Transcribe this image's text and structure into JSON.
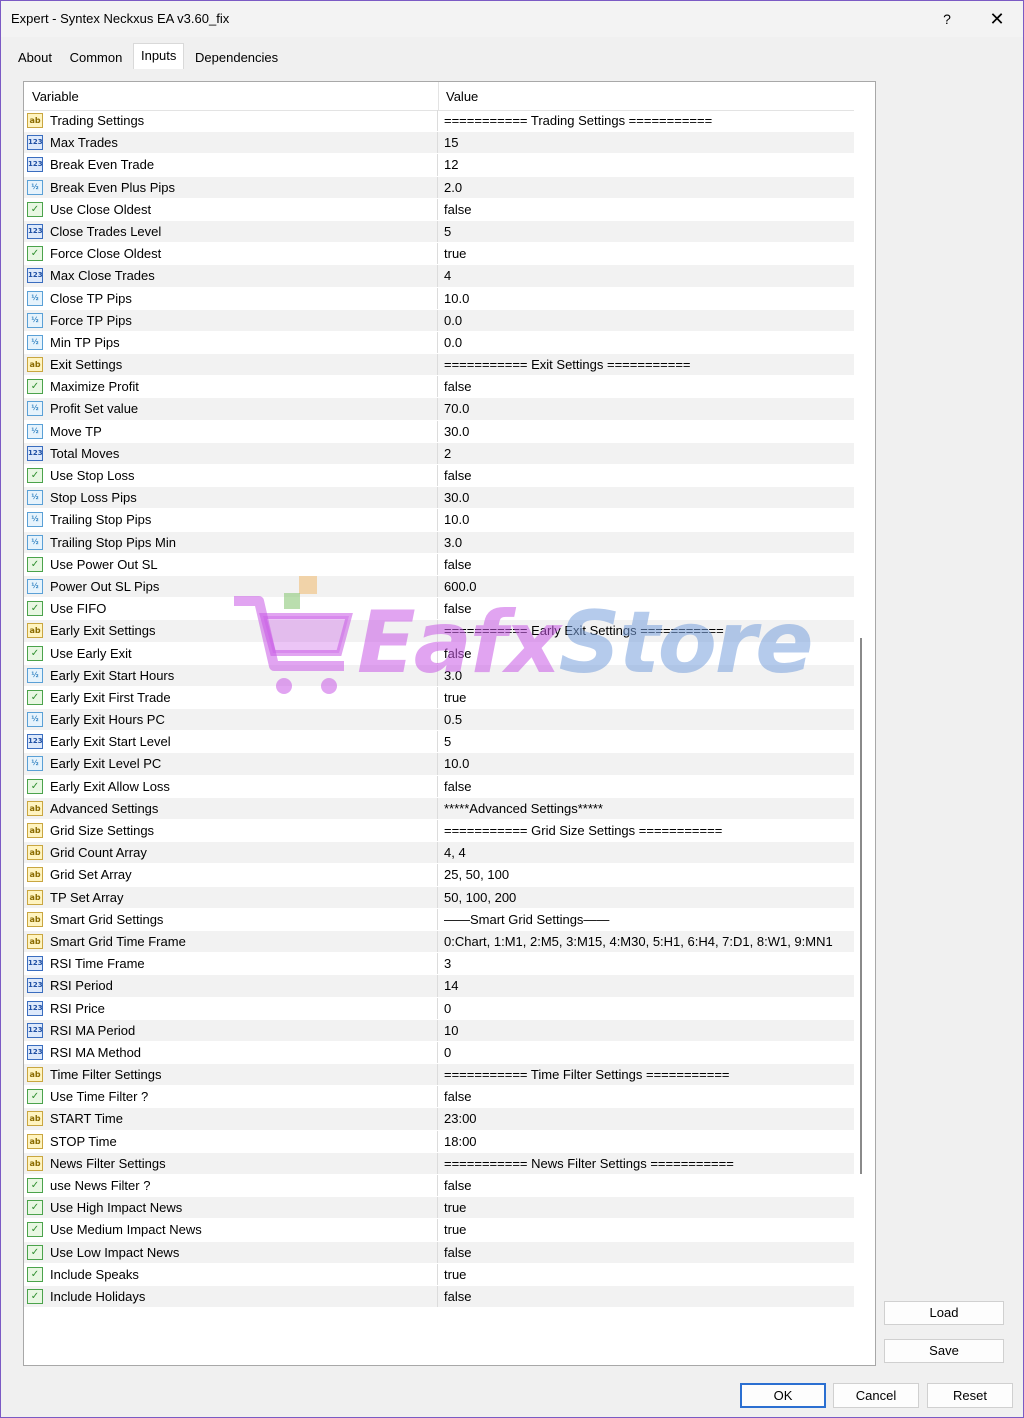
{
  "window": {
    "title": "Expert - Syntex Neckxus EA v3.60_fix",
    "help_label": "?",
    "close_label": "✕"
  },
  "tabs": [
    {
      "label": "About"
    },
    {
      "label": "Common"
    },
    {
      "label": "Inputs",
      "active": true
    },
    {
      "label": "Dependencies"
    }
  ],
  "table": {
    "headers": {
      "variable": "Variable",
      "value": "Value"
    },
    "rows": [
      {
        "type": "str",
        "name": "Trading Settings",
        "value": "=========== Trading Settings ==========="
      },
      {
        "type": "int",
        "name": "Max Trades",
        "value": "15"
      },
      {
        "type": "int",
        "name": "Break Even Trade",
        "value": "12"
      },
      {
        "type": "dbl",
        "name": "Break Even Plus Pips",
        "value": "2.0"
      },
      {
        "type": "bool",
        "name": "Use Close Oldest",
        "value": "false"
      },
      {
        "type": "int",
        "name": "Close Trades Level",
        "value": "5"
      },
      {
        "type": "bool",
        "name": "Force Close Oldest",
        "value": "true"
      },
      {
        "type": "int",
        "name": "Max Close Trades",
        "value": "4"
      },
      {
        "type": "dbl",
        "name": "Close TP Pips",
        "value": "10.0"
      },
      {
        "type": "dbl",
        "name": "Force TP Pips",
        "value": "0.0"
      },
      {
        "type": "dbl",
        "name": "Min TP Pips",
        "value": "0.0"
      },
      {
        "type": "str",
        "name": "Exit Settings",
        "value": "=========== Exit Settings ==========="
      },
      {
        "type": "bool",
        "name": "Maximize Profit",
        "value": "false"
      },
      {
        "type": "dbl",
        "name": "Profit Set value",
        "value": "70.0"
      },
      {
        "type": "dbl",
        "name": "Move TP",
        "value": "30.0"
      },
      {
        "type": "int",
        "name": "Total Moves",
        "value": "2"
      },
      {
        "type": "bool",
        "name": "Use Stop Loss",
        "value": "false"
      },
      {
        "type": "dbl",
        "name": "Stop Loss Pips",
        "value": "30.0"
      },
      {
        "type": "dbl",
        "name": "Trailing Stop Pips",
        "value": "10.0"
      },
      {
        "type": "dbl",
        "name": "Trailing Stop Pips Min",
        "value": "3.0"
      },
      {
        "type": "bool",
        "name": "Use Power Out SL",
        "value": "false"
      },
      {
        "type": "dbl",
        "name": "Power Out SL Pips",
        "value": "600.0"
      },
      {
        "type": "bool",
        "name": "Use FIFO",
        "value": "false"
      },
      {
        "type": "str",
        "name": "Early Exit Settings",
        "value": "=========== Early Exit Settings ==========="
      },
      {
        "type": "bool",
        "name": "Use Early Exit",
        "value": "false"
      },
      {
        "type": "dbl",
        "name": "Early Exit Start Hours",
        "value": "3.0"
      },
      {
        "type": "bool",
        "name": "Early Exit First Trade",
        "value": "true"
      },
      {
        "type": "dbl",
        "name": "Early Exit Hours PC",
        "value": "0.5"
      },
      {
        "type": "int",
        "name": "Early Exit Start Level",
        "value": "5"
      },
      {
        "type": "dbl",
        "name": "Early Exit Level PC",
        "value": "10.0"
      },
      {
        "type": "bool",
        "name": "Early Exit Allow Loss",
        "value": "false"
      },
      {
        "type": "str",
        "name": "Advanced Settings",
        "value": "*****Advanced Settings*****"
      },
      {
        "type": "str",
        "name": "Grid Size Settings",
        "value": "=========== Grid Size Settings ==========="
      },
      {
        "type": "str",
        "name": "Grid Count Array",
        "value": "4, 4"
      },
      {
        "type": "str",
        "name": "Grid Set Array",
        "value": "25, 50, 100"
      },
      {
        "type": "str",
        "name": "TP Set Array",
        "value": "50, 100, 200"
      },
      {
        "type": "str",
        "name": "Smart Grid Settings",
        "value": "——Smart Grid Settings——"
      },
      {
        "type": "str",
        "name": "Smart Grid Time Frame",
        "value": "0:Chart, 1:M1, 2:M5, 3:M15, 4:M30, 5:H1, 6:H4, 7:D1, 8:W1, 9:MN1"
      },
      {
        "type": "int",
        "name": "RSI Time Frame",
        "value": "3"
      },
      {
        "type": "int",
        "name": "RSI Period",
        "value": "14"
      },
      {
        "type": "int",
        "name": "RSI Price",
        "value": "0"
      },
      {
        "type": "int",
        "name": "RSI MA Period",
        "value": "10"
      },
      {
        "type": "int",
        "name": "RSI MA Method",
        "value": "0"
      },
      {
        "type": "str",
        "name": "Time Filter Settings",
        "value": "=========== Time Filter Settings ==========="
      },
      {
        "type": "bool",
        "name": "Use Time Filter ?",
        "value": "false"
      },
      {
        "type": "str",
        "name": "START Time",
        "value": "23:00"
      },
      {
        "type": "str",
        "name": "STOP Time",
        "value": "18:00"
      },
      {
        "type": "str",
        "name": "News Filter Settings",
        "value": "=========== News Filter Settings ==========="
      },
      {
        "type": "bool",
        "name": "use News Filter ?",
        "value": "false"
      },
      {
        "type": "bool",
        "name": "Use High Impact News",
        "value": "true"
      },
      {
        "type": "bool",
        "name": "Use Medium Impact News",
        "value": "true"
      },
      {
        "type": "bool",
        "name": "Use Low Impact News",
        "value": "false"
      },
      {
        "type": "bool",
        "name": "Include Speaks",
        "value": "true"
      },
      {
        "type": "bool",
        "name": "Include Holidays",
        "value": "false"
      }
    ]
  },
  "icon_glyphs": {
    "str": "ab",
    "int": "123",
    "dbl": "½",
    "bool": "✓"
  },
  "side_buttons": {
    "load": "Load",
    "save": "Save"
  },
  "bottom_buttons": {
    "ok": "OK",
    "cancel": "Cancel",
    "reset": "Reset"
  },
  "watermark": {
    "part1": "Eafx",
    "part2": "Store"
  }
}
